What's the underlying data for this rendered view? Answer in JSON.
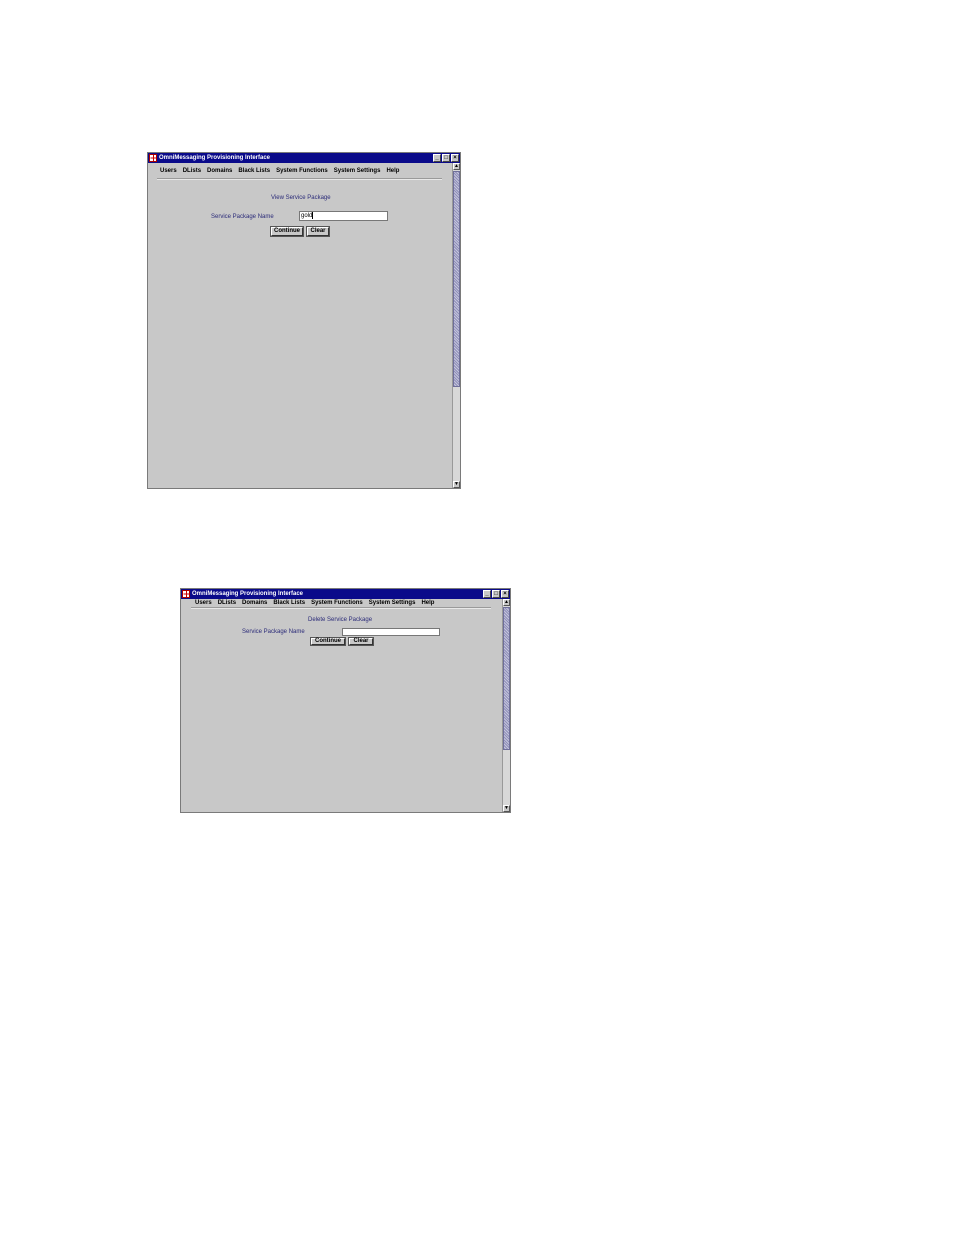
{
  "window1": {
    "title": "OmniMessaging Provisioning Interface",
    "menu": [
      "Users",
      "DLists",
      "Domains",
      "Black Lists",
      "System Functions",
      "System Settings",
      "Help"
    ],
    "form_title": "View Service Package",
    "field_label": "Service Package Name",
    "field_value": "gold",
    "continue_label": "Continue",
    "clear_label": "Clear",
    "scroll_position": 0.0,
    "scroll_visible_fraction": 0.7
  },
  "window2": {
    "title": "OmniMessaging Provisioning Interface",
    "menu": [
      "Users",
      "DLists",
      "Domains",
      "Black Lists",
      "System Functions",
      "System Settings",
      "Help"
    ],
    "form_title": "Delete Service Package",
    "field_label": "Service Package Name",
    "field_value": "",
    "continue_label": "Continue",
    "clear_label": "Clear",
    "scroll_position": 0.0,
    "scroll_visible_fraction": 0.7
  },
  "window_buttons": {
    "minimize": "_",
    "maximize": "□",
    "close": "×"
  },
  "scroll_arrows": {
    "up": "▲",
    "down": "▼"
  }
}
